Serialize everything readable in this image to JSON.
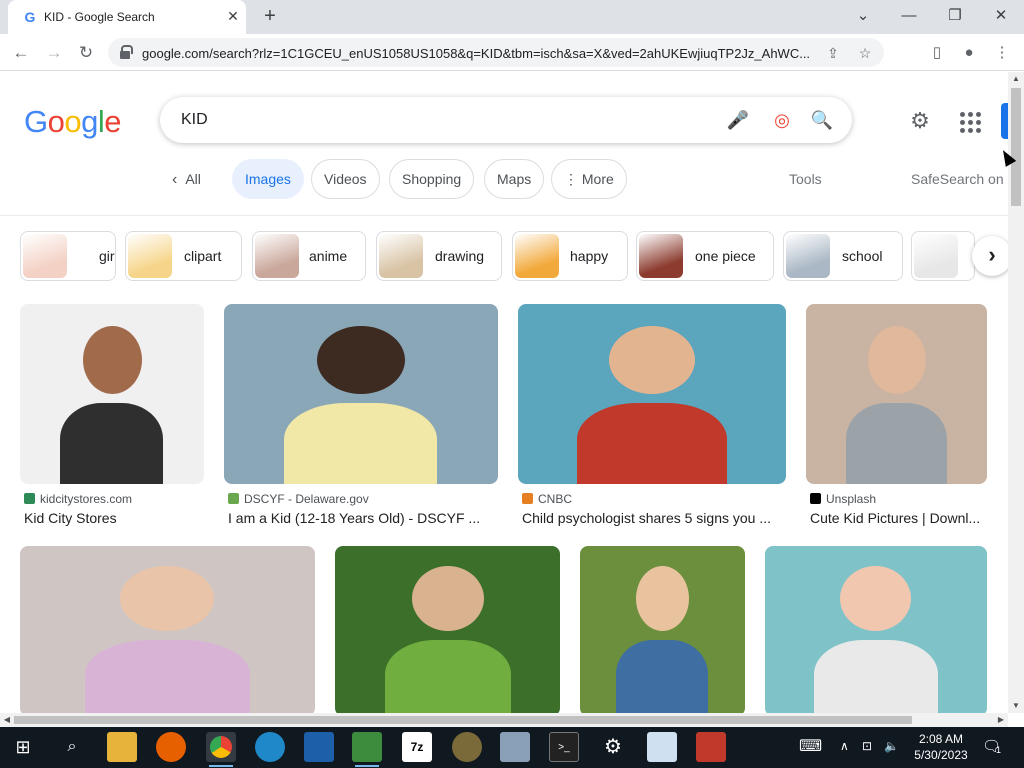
{
  "browser": {
    "tab_title": "KID - Google Search",
    "tab_favicon": "G",
    "new_tab_symbol": "+",
    "url": "google.com/search?rlz=1C1GCEU_enUS1058US1058&q=KID&tbm=isch&sa=X&ved=2ahUKEwjiuqTP2Jz_AhWC...",
    "icons": {
      "minimize": "—",
      "maximize": "❐",
      "close": "✕",
      "chevron": "⌄",
      "back": "←",
      "forward": "→",
      "reload": "↻",
      "share": "⇪",
      "bookmark": "☆",
      "sidepanel": "▯",
      "profile": "●",
      "menu": "⋮"
    }
  },
  "google": {
    "logo_letters": [
      {
        "ch": "G",
        "color": "#4285f4"
      },
      {
        "ch": "o",
        "color": "#ea4335"
      },
      {
        "ch": "o",
        "color": "#fbbc05"
      },
      {
        "ch": "g",
        "color": "#4285f4"
      },
      {
        "ch": "l",
        "color": "#34a853"
      },
      {
        "ch": "e",
        "color": "#ea4335"
      }
    ],
    "query": "KID",
    "search_icons": {
      "mic": "🎤",
      "lens": "◎",
      "search": "🔍"
    },
    "settings_icon": "⚙"
  },
  "filters": {
    "back_label": "All",
    "tabs": [
      "Images",
      "Videos",
      "Shopping",
      "Maps",
      "More"
    ],
    "more_symbol": "⋮",
    "tools": "Tools",
    "safesearch": "SafeSearch on"
  },
  "chips": [
    {
      "label": "girl",
      "color": "#f3d1c4"
    },
    {
      "label": "clipart",
      "color": "#f6d58a"
    },
    {
      "label": "anime",
      "color": "#c9a79a"
    },
    {
      "label": "drawing",
      "color": "#d8c3a5"
    },
    {
      "label": "happy",
      "color": "#f2a93b"
    },
    {
      "label": "one piece",
      "color": "#8c3b2e"
    },
    {
      "label": "school",
      "color": "#aab7c4"
    },
    {
      "label": "",
      "color": "#e7e7e7"
    }
  ],
  "chip_next_symbol": "›",
  "results": [
    {
      "source": "kidcitystores.com",
      "title": "Kid City Stores",
      "fav": "#2e8b57",
      "colors": [
        "#f0f0f0",
        "#a06a4b",
        "#2f2f2f"
      ]
    },
    {
      "source": "DSCYF - Delaware.gov",
      "title": "I am a Kid (12-18 Years Old) - DSCYF ...",
      "fav": "#6aa84f",
      "colors": [
        "#8aa7b8",
        "#3d2a20",
        "#f1e7a6"
      ]
    },
    {
      "source": "CNBC",
      "title": "Child psychologist shares 5 signs you ...",
      "fav": "#e67e22",
      "colors": [
        "#5ba6bd",
        "#e3b490",
        "#c0392b"
      ]
    },
    {
      "source": "Unsplash",
      "title": "Cute Kid Pictures | Downl...",
      "fav": "#000000",
      "colors": [
        "#c9b3a3",
        "#e0b89b",
        "#9ca3a8"
      ]
    },
    {
      "source": "",
      "title": "",
      "fav": "",
      "colors": [
        "#cfc6c3",
        "#e9c4a8",
        "#d9b3d6"
      ]
    },
    {
      "source": "",
      "title": "",
      "fav": "",
      "colors": [
        "#3b6f2a",
        "#d9b28f",
        "#6fae3f"
      ]
    },
    {
      "source": "",
      "title": "",
      "fav": "",
      "colors": [
        "#6c8f3e",
        "#e8c39e",
        "#3f6ea3"
      ]
    },
    {
      "source": "",
      "title": "",
      "fav": "",
      "colors": [
        "#7fc3c9",
        "#f1c7b0",
        "#e9e9e9"
      ]
    }
  ],
  "taskbar": {
    "time": "2:08 AM",
    "date": "5/30/2023",
    "notification_count": "1",
    "apps": [
      "windows",
      "search",
      "file-explorer",
      "firefox",
      "chrome",
      "edge",
      "photos",
      "sheets",
      "7zip",
      "settings-app",
      "viewer",
      "cmd",
      "gear",
      "notepad",
      "toolbox"
    ]
  }
}
